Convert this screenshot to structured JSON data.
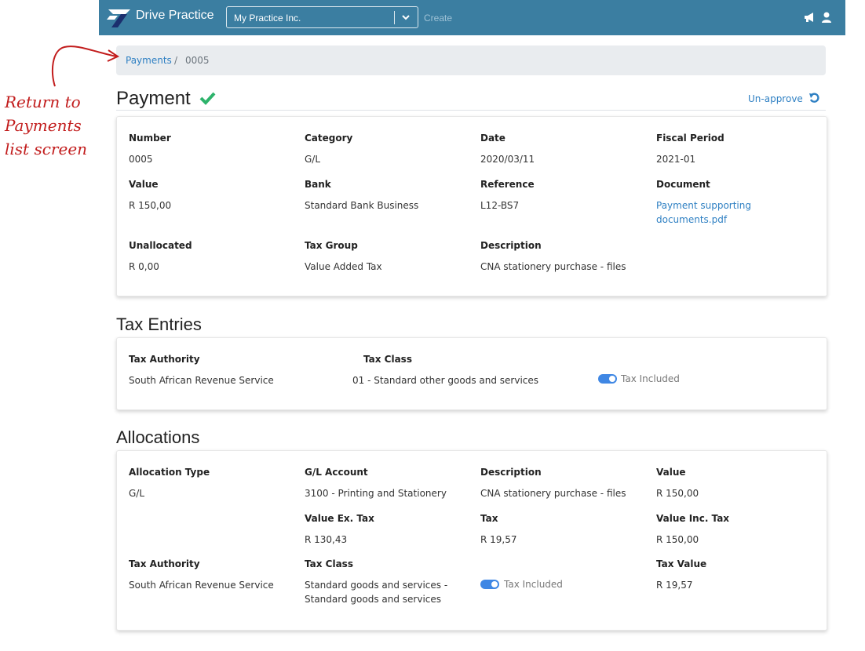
{
  "header": {
    "brand": "Drive Practice",
    "company": "My Practice Inc.",
    "create_label": "Create"
  },
  "breadcrumb": {
    "parent": "Payments",
    "separator": "/",
    "current": "0005"
  },
  "annotation": {
    "lines": [
      "Return to",
      "Payments",
      "list screen"
    ]
  },
  "page": {
    "title": "Payment",
    "unapprove_label": "Un-approve"
  },
  "payment": {
    "number_label": "Number",
    "number": "0005",
    "category_label": "Category",
    "category": "G/L",
    "date_label": "Date",
    "date": "2020/03/11",
    "fiscal_label": "Fiscal Period",
    "fiscal": "2021-01",
    "value_label": "Value",
    "value": "R 150,00",
    "bank_label": "Bank",
    "bank": "Standard Bank Business",
    "reference_label": "Reference",
    "reference": "L12-BS7",
    "document_label": "Document",
    "document_line1": "Payment supporting",
    "document_line2": "documents.pdf",
    "unallocated_label": "Unallocated",
    "unallocated": "R 0,00",
    "taxgroup_label": "Tax Group",
    "taxgroup": "Value Added Tax",
    "description_label": "Description",
    "description": "CNA stationery purchase - files"
  },
  "tax_entries": {
    "heading": "Tax Entries",
    "authority_label": "Tax Authority",
    "authority": "South African Revenue Service",
    "class_label": "Tax Class",
    "class": "01 - Standard other goods and services",
    "toggle_label": "Tax Included"
  },
  "allocations": {
    "heading": "Allocations",
    "type_label": "Allocation Type",
    "type": "G/L",
    "account_label": "G/L Account",
    "account": "3100 - Printing and Stationery",
    "description_label": "Description",
    "description": "CNA stationery purchase - files",
    "value_label": "Value",
    "value": "R 150,00",
    "value_ex_label": "Value Ex. Tax",
    "value_ex": "R 130,43",
    "tax_label": "Tax",
    "tax": "R 19,57",
    "value_inc_label": "Value Inc. Tax",
    "value_inc": "R 150,00",
    "authority_label": "Tax Authority",
    "authority": "South African Revenue Service",
    "class_label": "Tax Class",
    "class_line1": "Standard goods and services -",
    "class_line2": "Standard goods and services",
    "toggle_label": "Tax Included",
    "tax_value_label": "Tax Value",
    "tax_value": "R 19,57"
  },
  "colors": {
    "topbar": "#3b7ea1",
    "link": "#2f80c3",
    "check": "#2db36b",
    "annotation": "#c21d1d",
    "toggle": "#3f87e4"
  },
  "icons": [
    "logo-icon",
    "chevron-down-icon",
    "megaphone-icon",
    "user-icon",
    "check-icon",
    "undo-icon"
  ]
}
